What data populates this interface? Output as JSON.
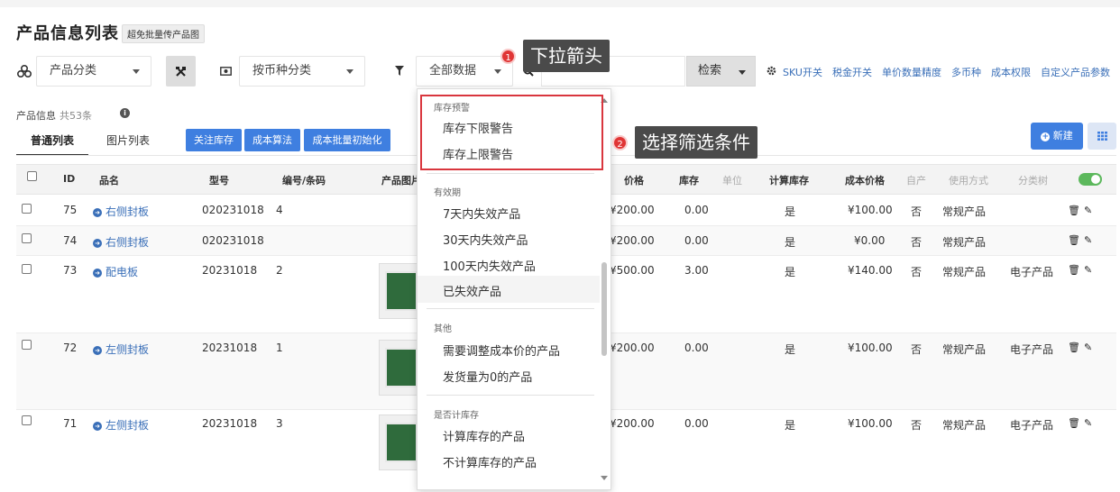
{
  "header": {
    "title": "产品信息列表",
    "badge": "超免批量传产品图"
  },
  "filters": {
    "category": "产品分类",
    "currency": "按币种分类",
    "data_filter": "全部数据",
    "search_value": "",
    "search_button": "检索"
  },
  "links": [
    "SKU开关",
    "税金开关",
    "单价数量精度",
    "多币种",
    "成本权限",
    "自定义产品参数"
  ],
  "info": {
    "label": "产品信息",
    "count": "共53条"
  },
  "tabs": [
    "普通列表",
    "图片列表"
  ],
  "actions": {
    "follow_stock": "关注库存",
    "cost_method": "成本算法",
    "cost_batch_init": "成本批量初始化",
    "new_label": "新建"
  },
  "columns": {
    "id": "ID",
    "name": "品名",
    "model": "型号",
    "code": "编号/条码",
    "image": "产品图片",
    "price": "价格",
    "stock": "库存",
    "unit": "单位",
    "calc_stock": "计算库存",
    "cost": "成本价格",
    "self_made": "自产",
    "usage": "使用方式",
    "category_tree": "分类树"
  },
  "rows": [
    {
      "id": "75",
      "name": "右侧封板",
      "model": "020231018",
      "code": "4",
      "price": "¥200.00",
      "stock": "0.00",
      "calc": "是",
      "cost": "¥100.00",
      "self": "否",
      "usage": "常规产品",
      "cat": ""
    },
    {
      "id": "74",
      "name": "右侧封板",
      "model": "020231018",
      "code": "",
      "price": "¥200.00",
      "stock": "0.00",
      "calc": "是",
      "cost": "¥0.00",
      "self": "否",
      "usage": "常规产品",
      "cat": ""
    },
    {
      "id": "73",
      "name": "配电板",
      "model": "20231018",
      "code": "2",
      "price": "¥500.00",
      "stock": "3.00",
      "calc": "是",
      "cost": "¥140.00",
      "self": "否",
      "usage": "常规产品",
      "cat": "电子产品"
    },
    {
      "id": "72",
      "name": "左侧封板",
      "model": "20231018",
      "code": "1",
      "price": "¥200.00",
      "stock": "0.00",
      "calc": "是",
      "cost": "¥100.00",
      "self": "否",
      "usage": "常规产品",
      "cat": "电子产品"
    },
    {
      "id": "71",
      "name": "左侧封板",
      "model": "20231018",
      "code": "3",
      "price": "¥200.00",
      "stock": "0.00",
      "calc": "是",
      "cost": "¥100.00",
      "self": "否",
      "usage": "常规产品",
      "cat": "电子产品"
    }
  ],
  "dropdown": {
    "groups": [
      {
        "title": "库存预警",
        "items": [
          "库存下限警告",
          "库存上限警告"
        ]
      },
      {
        "title": "有效期",
        "items": [
          "7天内失效产品",
          "30天内失效产品",
          "100天内失效产品",
          "已失效产品"
        ]
      },
      {
        "title": "其他",
        "items": [
          "需要调整成本价的产品",
          "发货量为0的产品"
        ]
      },
      {
        "title": "是否计库存",
        "items": [
          "计算库存的产品",
          "不计算库存的产品"
        ]
      }
    ]
  },
  "annotations": [
    {
      "number": "1",
      "text": "下拉箭头"
    },
    {
      "number": "2",
      "text": "选择筛选条件"
    }
  ],
  "icons": {
    "category": "cubes-icon",
    "tool": "tools-icon",
    "currency": "money-icon",
    "filter": "filter-icon",
    "search": "search-icon",
    "settings": "gear-icon",
    "info": "info-icon",
    "plus": "plus-circle-icon",
    "grid": "grid-icon",
    "trash": "trash-icon",
    "edit": "pencil-icon",
    "arrow": "arrow-circle-icon"
  },
  "colors": {
    "primary": "#3f7fe0",
    "link": "#3a6fb8",
    "annotation": "#e03535",
    "highlight": "#d9363e",
    "toggle_on": "#5cb85c"
  }
}
